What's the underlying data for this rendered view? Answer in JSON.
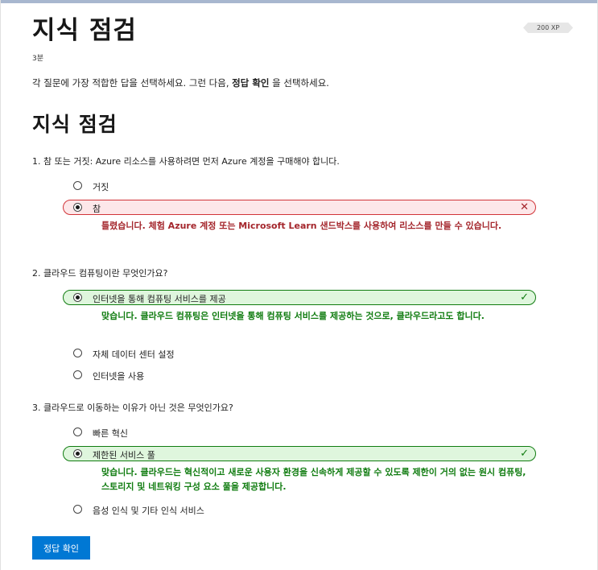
{
  "header": {
    "title": "지식 점검",
    "duration": "3분",
    "xp_badge": "200 XP"
  },
  "intro": {
    "before": "각 질문에 가장 적합한 답을 선택하세요. 그런 다음, ",
    "bold": "정답 확인",
    "after": " 을 선택하세요."
  },
  "section_title": "지식 점검",
  "questions": [
    {
      "text": "1. 참 또는 거짓: Azure 리소스를 사용하려면 먼저 Azure 계정을 구매해야 합니다.",
      "options": [
        {
          "label": "거짓",
          "selected": false
        },
        {
          "label": "참",
          "selected": true,
          "status": "incorrect",
          "status_icon": "close-icon"
        }
      ],
      "feedback": "틀렸습니다. 체험 Azure 계정 또는 Microsoft Learn 샌드박스를 사용하여 리소스를 만들 수 있습니다."
    },
    {
      "text": "2. 클라우드 컴퓨팅이란 무엇인가요?",
      "options": [
        {
          "label": "인터넷을 통해 컴퓨팅 서비스를 제공",
          "selected": true,
          "status": "correct",
          "status_icon": "check-icon"
        },
        {
          "label": "자체 데이터 센터 설정",
          "selected": false
        },
        {
          "label": "인터넷을 사용",
          "selected": false
        }
      ],
      "feedback": "맞습니다. 클라우드 컴퓨팅은 인터넷을 통해 컴퓨팅 서비스를 제공하는 것으로, 클라우드라고도 합니다."
    },
    {
      "text": "3. 클라우드로 이동하는 이유가 아닌 것은 무엇인가요?",
      "options": [
        {
          "label": "빠른 혁신",
          "selected": false
        },
        {
          "label": "제한된 서비스 풀",
          "selected": true,
          "status": "correct",
          "status_icon": "check-icon"
        },
        {
          "label": "음성 인식 및 기타 인식 서비스",
          "selected": false
        }
      ],
      "feedback": "맞습니다. 클라우드는 혁신적이고 새로운 사용자 환경을 신속하게 제공할 수 있도록 제한이 거의 없는 원시 컴퓨팅, 스토리지 및 네트워킹 구성 요소 풀을 제공합니다."
    }
  ],
  "check_button_label": "정답 확인",
  "colors": {
    "incorrect_border": "#d13438",
    "incorrect_bg": "#fde7e9",
    "incorrect_text": "#a4262c",
    "correct_border": "#107c10",
    "correct_bg": "#dff6dd",
    "correct_text": "#107c10",
    "primary_button": "#0078d4"
  }
}
